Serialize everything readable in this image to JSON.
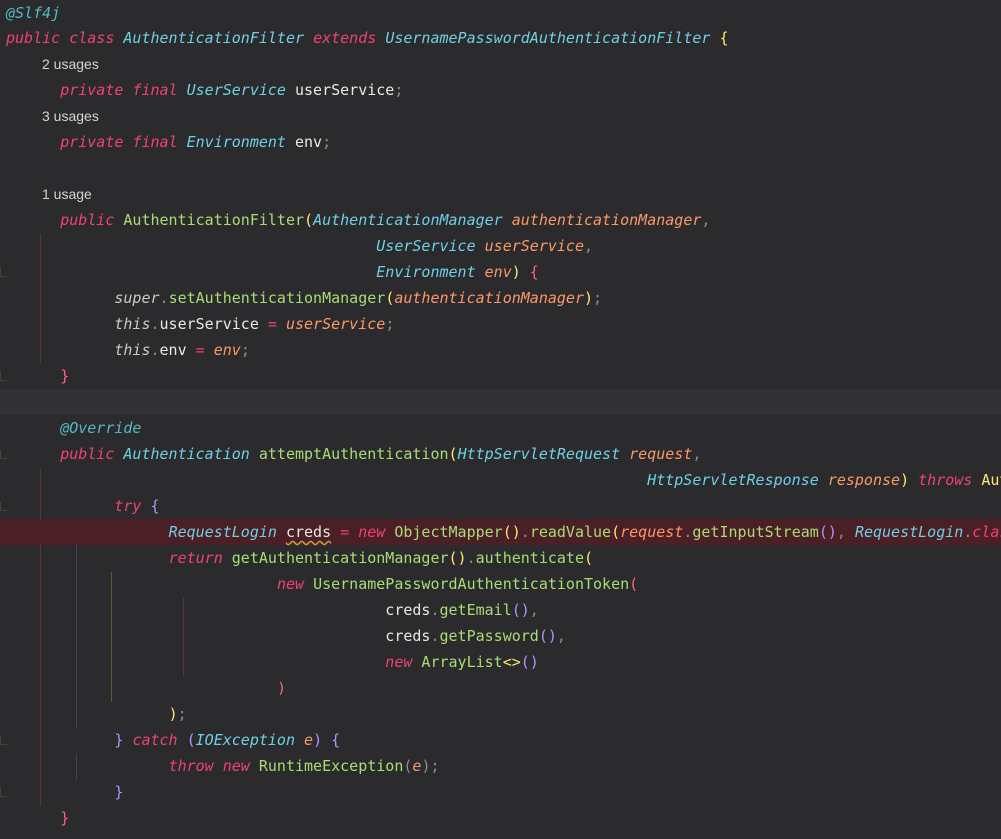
{
  "editor": {
    "language": "Java",
    "colors": {
      "background": "#2b2b2d",
      "error_line": "#4a1f26",
      "caret_line": "#323234",
      "keyword": "#f0407a",
      "type": "#6fd0e5",
      "function": "#a9dc76",
      "parameter": "#fc9867"
    },
    "hints": {
      "usage_1": "2 usages",
      "usage_2": "3 usages",
      "usage_3": "1 usage"
    },
    "lines": {
      "l1": [
        "@Slf4j"
      ],
      "l2": [
        "public",
        "class",
        "AuthenticationFilter",
        "extends",
        "UsernamePasswordAuthenticationFilter",
        "{"
      ],
      "l4": [
        "private",
        "final",
        "UserService",
        "userService",
        ";"
      ],
      "l6": [
        "private",
        "final",
        "Environment",
        "env",
        ";"
      ],
      "l9": [
        "public",
        "AuthenticationFilter",
        "(",
        "AuthenticationManager",
        "authenticationManager",
        ","
      ],
      "l10": [
        "UserService",
        "userService",
        ","
      ],
      "l11": [
        "Environment",
        "env",
        ")",
        "{"
      ],
      "l12": [
        "super",
        ".",
        "setAuthenticationManager",
        "(",
        "authenticationManager",
        ")",
        ";"
      ],
      "l13": [
        "this",
        ".",
        "userService",
        "=",
        "userService",
        ";"
      ],
      "l14": [
        "this",
        ".",
        "env",
        "=",
        "env",
        ";"
      ],
      "l15": [
        "}"
      ],
      "l17": [
        "@Override"
      ],
      "l18": [
        "public",
        "Authentication",
        "attemptAuthentication",
        "(",
        "HttpServletRequest",
        "request",
        ","
      ],
      "l19": [
        "HttpServletResponse",
        "response",
        ")",
        "throws",
        "AuthenticationException",
        "{"
      ],
      "l20": [
        "try",
        "{"
      ],
      "l21": [
        "RequestLogin",
        "creds",
        "=",
        "new",
        "ObjectMapper",
        "()",
        ".",
        "readValue",
        "(",
        "request",
        ".",
        "getInputStream",
        "()",
        ",",
        "RequestLogin",
        ".",
        "class",
        ")",
        ";"
      ],
      "l22": [
        "return",
        "getAuthenticationManager",
        "()",
        ".",
        "authenticate",
        "("
      ],
      "l23": [
        "new",
        "UsernamePasswordAuthenticationToken",
        "("
      ],
      "l24": [
        "creds",
        ".",
        "getEmail",
        "()",
        ","
      ],
      "l25": [
        "creds",
        ".",
        "getPassword",
        "()",
        ","
      ],
      "l26": [
        "new",
        "ArrayList",
        "<>",
        "()"
      ],
      "l27": [
        ")"
      ],
      "l28": [
        ")",
        ";"
      ],
      "l29": [
        "}",
        "catch",
        "(",
        "IOException",
        "e",
        ")",
        "{"
      ],
      "l30": [
        "throw",
        "new",
        "RuntimeException",
        "(",
        "e",
        ")",
        ";"
      ],
      "l31": [
        "}"
      ],
      "l32": [
        "}"
      ]
    }
  }
}
